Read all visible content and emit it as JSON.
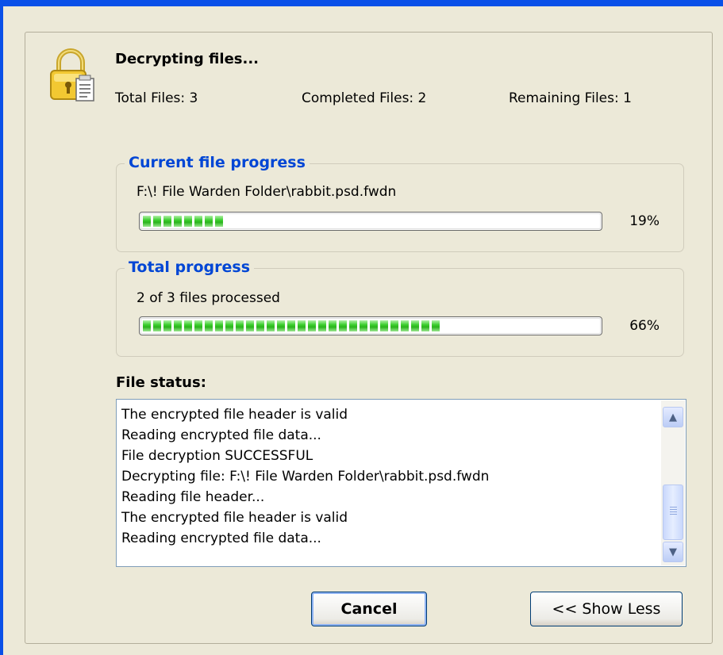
{
  "header": {
    "title": "Decrypting files...",
    "total_files": "Total Files: 3",
    "completed_files": "Completed Files: 2",
    "remaining_files": "Remaining Files: 1",
    "icon": "lock-icon"
  },
  "current_file": {
    "label": "Current file progress",
    "path": "F:\\! File Warden Folder\\rabbit.psd.fwdn",
    "percent_label": "19%",
    "progress_fraction": 0.19
  },
  "total": {
    "label": "Total progress",
    "status": "2 of 3 files processed",
    "percent_label": "66%",
    "progress_fraction": 0.66
  },
  "file_status": {
    "label": "File status:",
    "lines": [
      "The encrypted file header is valid",
      "Reading encrypted file data...",
      "File decryption SUCCESSFUL",
      "Decrypting file: F:\\! File Warden Folder\\rabbit.psd.fwdn",
      "Reading file header...",
      "The encrypted file header is valid",
      "Reading encrypted file data..."
    ]
  },
  "buttons": {
    "cancel": "Cancel",
    "show_less": "<< Show Less"
  },
  "colors": {
    "accent_title": "#0046d5",
    "progress_green": "#2ab41c",
    "window_bg": "#ece9d8"
  }
}
